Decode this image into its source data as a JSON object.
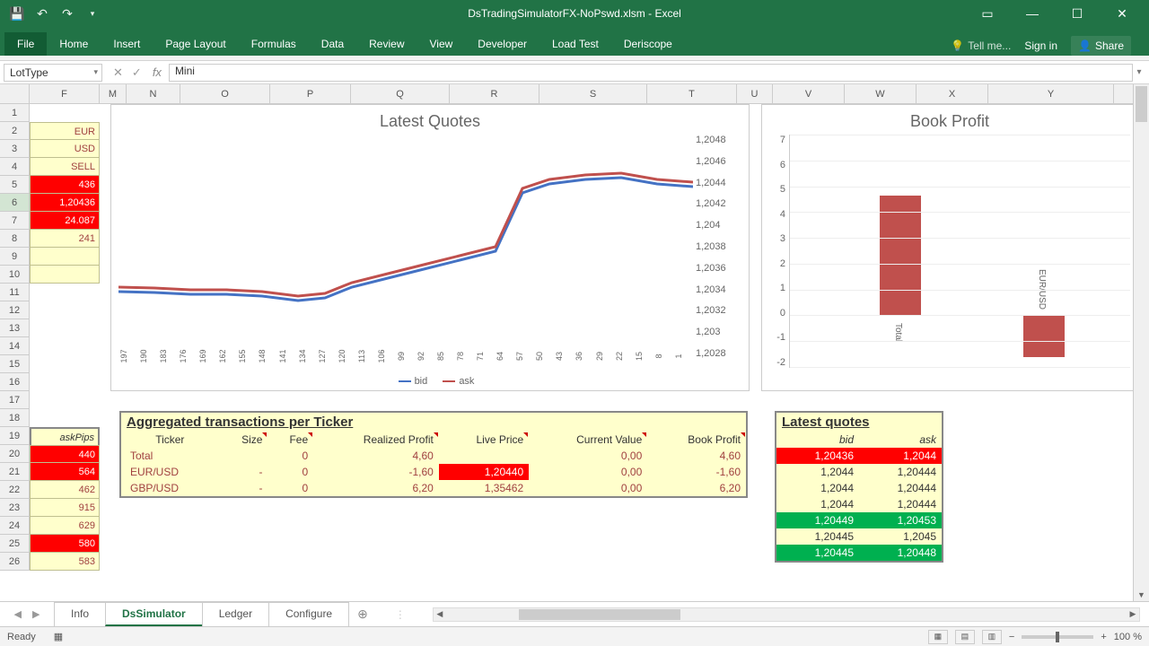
{
  "titlebar": {
    "title": "DsTradingSimulatorFX-NoPswd.xlsm - Excel"
  },
  "ribbon": {
    "tabs": [
      "File",
      "Home",
      "Insert",
      "Page Layout",
      "Formulas",
      "Data",
      "Review",
      "View",
      "Developer",
      "Load Test",
      "Deriscope"
    ],
    "tellme": "Tell me...",
    "signin": "Sign in",
    "share": "Share"
  },
  "namebox": "LotType",
  "formula": "Mini",
  "columns": [
    "F",
    "M",
    "N",
    "O",
    "P",
    "Q",
    "R",
    "S",
    "T",
    "U",
    "V",
    "W",
    "X",
    "Y"
  ],
  "rows": [
    "1",
    "2",
    "3",
    "4",
    "5",
    "6",
    "7",
    "8",
    "9",
    "10",
    "11",
    "12",
    "13",
    "14",
    "15",
    "16",
    "17",
    "18",
    "19",
    "20",
    "21",
    "22",
    "23",
    "24",
    "25",
    "26"
  ],
  "colF_top": [
    {
      "v": "EUR",
      "red": false
    },
    {
      "v": "USD",
      "red": false
    },
    {
      "v": "SELL",
      "red": false
    },
    {
      "v": "436",
      "red": true
    },
    {
      "v": "1,20436",
      "red": true
    },
    {
      "v": "24.087",
      "red": true
    },
    {
      "v": "241",
      "red": false
    }
  ],
  "askPips_label": "askPips",
  "colF_bottom": [
    {
      "v": "440",
      "red": true
    },
    {
      "v": "564",
      "red": true
    },
    {
      "v": "462",
      "red": false
    },
    {
      "v": "915",
      "red": false
    },
    {
      "v": "629",
      "red": false
    },
    {
      "v": "580",
      "red": true
    },
    {
      "v": "583",
      "red": false
    }
  ],
  "chart_data": [
    {
      "type": "line",
      "title": "Latest Quotes",
      "series": [
        {
          "name": "bid",
          "color": "#4472c4"
        },
        {
          "name": "ask",
          "color": "#c0504d"
        }
      ],
      "y_ticks": [
        "1,2048",
        "1,2046",
        "1,2044",
        "1,2042",
        "1,204",
        "1,2038",
        "1,2036",
        "1,2034",
        "1,2032",
        "1,203",
        "1,2028"
      ],
      "x_ticks": [
        "197",
        "190",
        "183",
        "176",
        "169",
        "162",
        "155",
        "148",
        "141",
        "134",
        "127",
        "120",
        "113",
        "106",
        "99",
        "92",
        "85",
        "78",
        "71",
        "64",
        "57",
        "50",
        "43",
        "36",
        "29",
        "22",
        "15",
        "8",
        "1"
      ],
      "ylim": [
        1.2028,
        1.2048
      ],
      "legend": [
        "bid",
        "ask"
      ]
    },
    {
      "type": "bar",
      "title": "Book Profit",
      "categories": [
        "Total",
        "EUR/USD"
      ],
      "values": [
        4.6,
        -1.6
      ],
      "y_ticks": [
        "7",
        "6",
        "5",
        "4",
        "3",
        "2",
        "1",
        "0",
        "-1",
        "-2"
      ],
      "ylim": [
        -2,
        7
      ]
    }
  ],
  "agg": {
    "title": "Aggregated transactions per Ticker",
    "headers": [
      "Ticker",
      "Size",
      "Fee",
      "Realized Profit",
      "Live Price",
      "Current Value",
      "Book Profit"
    ],
    "rows": [
      {
        "ticker": "Total",
        "size": "",
        "fee": "0",
        "rp": "4,60",
        "lp": "",
        "cv": "0,00",
        "bp": "4,60",
        "total": true
      },
      {
        "ticker": "EUR/USD",
        "size": "-",
        "fee": "0",
        "rp": "-1,60",
        "lp": "1,20440",
        "lp_red": true,
        "cv": "0,00",
        "bp": "-1,60"
      },
      {
        "ticker": "GBP/USD",
        "size": "-",
        "fee": "0",
        "rp": "6,20",
        "lp": "1,35462",
        "cv": "0,00",
        "bp": "6,20"
      }
    ]
  },
  "latest_quotes": {
    "title": "Latest quotes",
    "headers": [
      "bid",
      "ask"
    ],
    "rows": [
      {
        "bid": "1,20436",
        "ask": "1,2044",
        "cls": "red"
      },
      {
        "bid": "1,2044",
        "ask": "1,20444",
        "cls": ""
      },
      {
        "bid": "1,2044",
        "ask": "1,20444",
        "cls": ""
      },
      {
        "bid": "1,2044",
        "ask": "1,20444",
        "cls": ""
      },
      {
        "bid": "1,20449",
        "ask": "1,20453",
        "cls": "green"
      },
      {
        "bid": "1,20445",
        "ask": "1,2045",
        "cls": ""
      },
      {
        "bid": "1,20445",
        "ask": "1,20448",
        "cls": "green"
      }
    ]
  },
  "sheets": [
    "Info",
    "DsSimulator",
    "Ledger",
    "Configure"
  ],
  "active_sheet": 1,
  "status": {
    "ready": "Ready",
    "zoom": "100 %"
  }
}
